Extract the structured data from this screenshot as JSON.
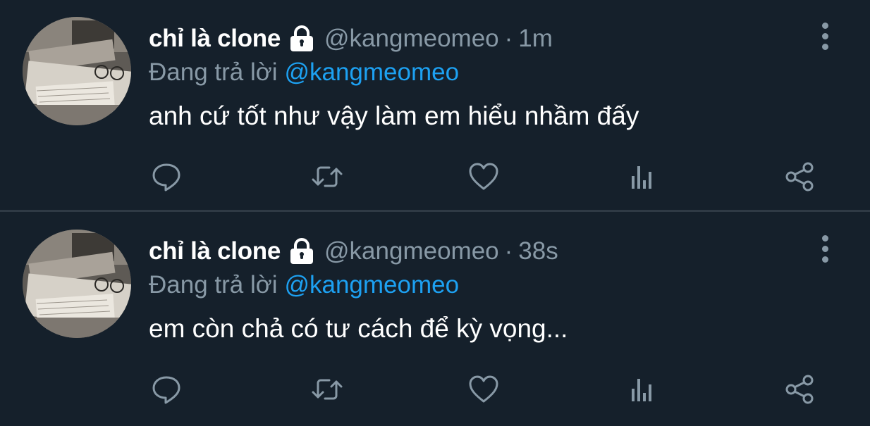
{
  "colors": {
    "background": "#15202b",
    "primary_text": "#ffffff",
    "secondary_text": "#8899a6",
    "mention": "#1da1f2",
    "divider": "#2f3a45"
  },
  "tweets": [
    {
      "display_name": "chỉ là clone",
      "protected_icon": "lock-icon",
      "handle": "@kangmeomeo",
      "separator": "·",
      "time": "1m",
      "reply_prefix": "Đang trả lời",
      "reply_to": "@kangmeomeo",
      "text": "anh cứ tốt như vậy làm em hiểu nhầm đấy",
      "actions": [
        "reply-icon",
        "retweet-icon",
        "like-icon",
        "analytics-icon",
        "share-icon"
      ]
    },
    {
      "display_name": "chỉ là clone",
      "protected_icon": "lock-icon",
      "handle": "@kangmeomeo",
      "separator": "·",
      "time": "38s",
      "reply_prefix": "Đang trả lời",
      "reply_to": "@kangmeomeo",
      "text": "em còn chả có tư cách để kỳ vọng...",
      "actions": [
        "reply-icon",
        "retweet-icon",
        "like-icon",
        "analytics-icon",
        "share-icon"
      ]
    }
  ]
}
